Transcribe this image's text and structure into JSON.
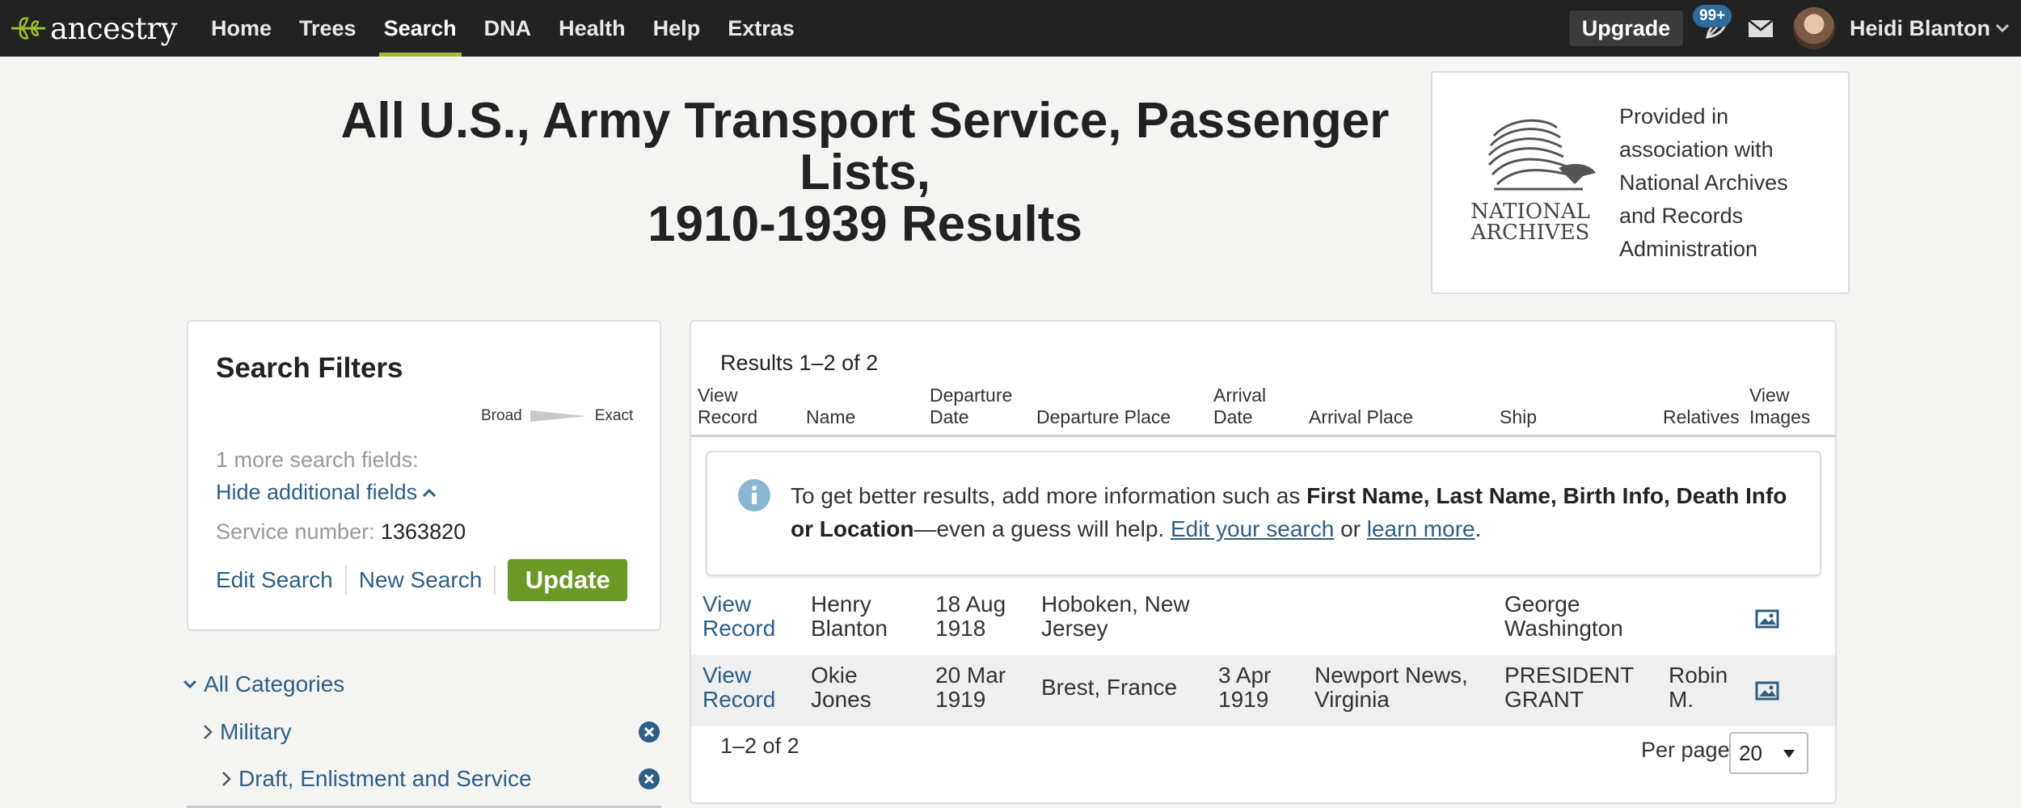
{
  "nav": {
    "logo_text": "ancestry",
    "items": [
      {
        "label": "Home"
      },
      {
        "label": "Trees"
      },
      {
        "label": "Search"
      },
      {
        "label": "DNA"
      },
      {
        "label": "Health"
      },
      {
        "label": "Help"
      },
      {
        "label": "Extras"
      }
    ],
    "active": "Search",
    "upgrade_label": "Upgrade",
    "notification_badge": "99+",
    "user_name": "Heidi Blanton"
  },
  "header": {
    "title_line1": "All U.S., Army Transport Service, Passenger Lists,",
    "title_line2": "1910-1939 Results",
    "provider_text": "Provided in association with National Archives and Records Administration",
    "provider_logo_line1": "NATIONAL",
    "provider_logo_line2": "ARCHIVES"
  },
  "filters": {
    "title": "Search Filters",
    "broad_label": "Broad",
    "exact_label": "Exact",
    "more_fields": "1 more search fields:",
    "hide_fields": "Hide additional fields",
    "service_label": "Service number:",
    "service_value": "1363820",
    "edit_search": "Edit Search",
    "new_search": "New Search",
    "update": "Update"
  },
  "categories": {
    "all": "All Categories",
    "military": "Military",
    "draft": "Draft, Enlistment and Service"
  },
  "results": {
    "count": "Results 1–2 of 2",
    "columns": {
      "view_record_1": "View",
      "view_record_2": "Record",
      "name": "Name",
      "departure_date_1": "Departure",
      "departure_date_2": "Date",
      "departure_place": "Departure Place",
      "arrival_date_1": "Arrival",
      "arrival_date_2": "Date",
      "arrival_place": "Arrival Place",
      "ship": "Ship",
      "relatives": "Relatives",
      "view_images_1": "View",
      "view_images_2": "Images"
    },
    "info": {
      "prefix": "To get better results, add more information such as ",
      "bold": "First Name, Last Name, Birth Info, Death Info or Location",
      "middle": "—even a guess will help. ",
      "edit_link": "Edit your search",
      "or": " or ",
      "learn_link": "learn more",
      "suffix": "."
    },
    "rows": [
      {
        "view_1": "View",
        "view_2": "Record",
        "name_1": "Henry",
        "name_2": "Blanton",
        "dep_date_1": "18 Aug",
        "dep_date_2": "1918",
        "dep_place_1": "Hoboken, New",
        "dep_place_2": "Jersey",
        "arr_date_1": "",
        "arr_date_2": "",
        "arr_place_1": "",
        "arr_place_2": "",
        "ship_1": "George",
        "ship_2": "Washington",
        "rel_1": "",
        "rel_2": ""
      },
      {
        "view_1": "View",
        "view_2": "Record",
        "name_1": "Okie",
        "name_2": "Jones",
        "dep_date_1": "20 Mar",
        "dep_date_2": "1919",
        "dep_place_1": "Brest, France",
        "dep_place_2": "",
        "arr_date_1": "3 Apr",
        "arr_date_2": "1919",
        "arr_place_1": "Newport News,",
        "arr_place_2": "Virginia",
        "ship_1": "PRESIDENT",
        "ship_2": "GRANT",
        "rel_1": "Robin",
        "rel_2": "M."
      }
    ],
    "pager": "1–2 of 2",
    "per_page_label": "Per page",
    "per_page_value": "20"
  }
}
